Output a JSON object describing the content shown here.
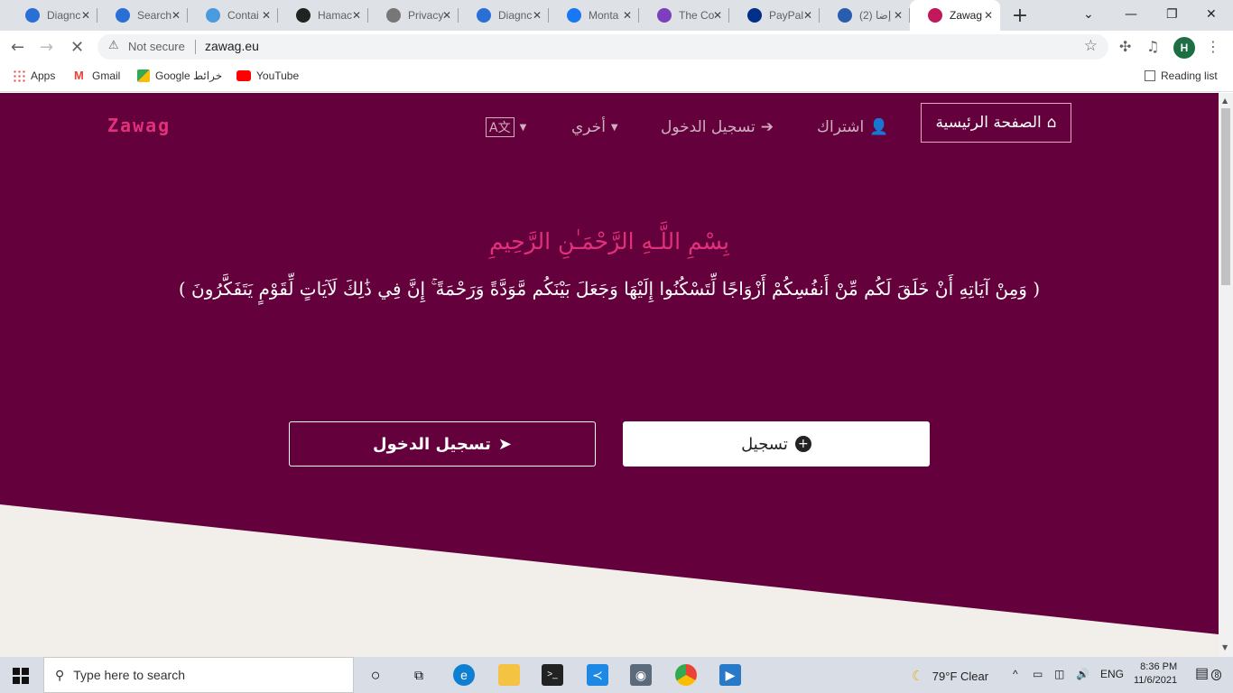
{
  "browser": {
    "tabs": [
      {
        "title": "Diagnc",
        "fav": "#2a6fd6"
      },
      {
        "title": "Search",
        "fav": "#2a6fd6"
      },
      {
        "title": "Contai",
        "fav": "#4a9ae0"
      },
      {
        "title": "Hamac",
        "fav": "#222222"
      },
      {
        "title": "Privacy",
        "fav": "#777777"
      },
      {
        "title": "Diagnc",
        "fav": "#2a6fd6"
      },
      {
        "title": "Monta",
        "fav": "#1877f2"
      },
      {
        "title": "The Co",
        "fav": "#7e3fbf"
      },
      {
        "title": "PayPal",
        "fav": "#003087"
      },
      {
        "title": "(2) إضا",
        "fav": "#2a5db0"
      },
      {
        "title": "Zawag",
        "fav": "#c2185b",
        "active": true
      }
    ],
    "address": {
      "security": "Not secure",
      "url": "zawag.eu"
    },
    "profile_initial": "H",
    "bookmarks": {
      "apps": "Apps",
      "gmail": "Gmail",
      "maps": "Google خرائط",
      "youtube": "YouTube",
      "reading_list": "Reading list"
    }
  },
  "site": {
    "brand": "Zawag",
    "nav": {
      "home": "الصفحة الرئيسية",
      "signup": "اشتراك",
      "login": "تسجيل الدخول",
      "other": "أخري"
    },
    "basmala": "بِسْمِ اللَّـهِ الرَّحْمَـٰنِ الرَّحِيمِ",
    "ayah": "( وَمِنْ آيَاتِهِ أَنْ خَلَقَ لَكُم مِّنْ أَنفُسِكُمْ أَزْوَاجًا لِّتَسْكُنُوا إِلَيْهَا وَجَعَلَ بَيْنَكُم مَّوَدَّةً وَرَحْمَةً ۚ إِنَّ فِي ذَٰلِكَ لَآيَاتٍ لِّقَوْمٍ يَتَفَكَّرُونَ )",
    "buttons": {
      "login": "تسجيل الدخول",
      "signup": "تسجيل"
    }
  },
  "taskbar": {
    "search_placeholder": "Type here to search",
    "weather": "79°F  Clear",
    "lang": "ENG",
    "time": "8:36 PM",
    "date": "11/6/2021",
    "notifications": "8"
  },
  "colors": {
    "hero": "#64003b",
    "accent": "#e0317a",
    "bottom_bg": "#f2efeb"
  }
}
